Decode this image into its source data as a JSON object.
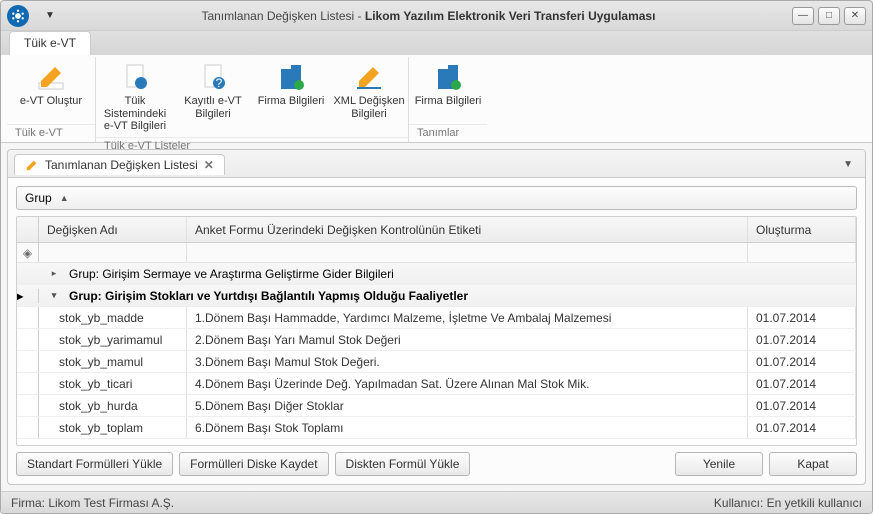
{
  "window": {
    "title_plain": "Tanımlanan Değişken Listesi - ",
    "title_bold": "Likom Yazılım Elektronik Veri Transferi Uygulaması"
  },
  "ribbon": {
    "tab_label": "Tüik e-VT",
    "groups": [
      {
        "label": "Tüik e-VT",
        "items": [
          {
            "label": "e-VT Oluştur"
          }
        ]
      },
      {
        "label": "Tüik e-VT Listeler",
        "items": [
          {
            "label": "Tüik Sistemindeki e-VT Bilgileri"
          },
          {
            "label": "Kayıtlı e-VT Bilgileri"
          },
          {
            "label": "Firma Bilgileri"
          },
          {
            "label": "XML Değişken Bilgileri"
          }
        ]
      },
      {
        "label": "Tanımlar",
        "items": [
          {
            "label": "Firma Bilgileri"
          }
        ]
      }
    ]
  },
  "page_tab": "Tanımlanan Değişken Listesi",
  "grid": {
    "group_box": "Grup",
    "columns": {
      "name": "Değişken Adı",
      "label": "Anket Formu Üzerindeki Değişken Kontrolünün Etiketi",
      "created": "Oluşturma"
    },
    "group1": "Grup: Girişim Sermaye ve Araştırma Geliştirme Gider Bilgileri",
    "group2": "Grup: Girişim Stokları ve Yurtdışı Bağlantılı Yapmış Olduğu Faaliyetler",
    "rows": [
      {
        "name": "stok_yb_madde",
        "label": "1.Dönem Başı Hammadde, Yardımcı Malzeme, İşletme Ve Ambalaj Malzemesi",
        "created": "01.07.2014"
      },
      {
        "name": "stok_yb_yarimamul",
        "label": "2.Dönem Başı Yarı Mamul Stok Değeri",
        "created": "01.07.2014"
      },
      {
        "name": "stok_yb_mamul",
        "label": "3.Dönem Başı Mamul Stok Değeri.",
        "created": "01.07.2014"
      },
      {
        "name": "stok_yb_ticari",
        "label": "4.Dönem Başı Üzerinde Değ. Yapılmadan Sat. Üzere Alınan Mal Stok Mik.",
        "created": "01.07.2014"
      },
      {
        "name": "stok_yb_hurda",
        "label": "5.Dönem Başı Diğer Stoklar",
        "created": "01.07.2014"
      },
      {
        "name": "stok_yb_toplam",
        "label": "6.Dönem Başı Stok Toplamı",
        "created": "01.07.2014"
      }
    ]
  },
  "buttons": {
    "load_std": "Standart Formülleri Yükle",
    "save_disk": "Formülleri Diske Kaydet",
    "load_disk": "Diskten Formül Yükle",
    "refresh": "Yenile",
    "close": "Kapat"
  },
  "status": {
    "firma": "Firma: Likom Test Firması A.Ş.",
    "user": "Kullanıcı: En yetkili kullanıcı"
  }
}
